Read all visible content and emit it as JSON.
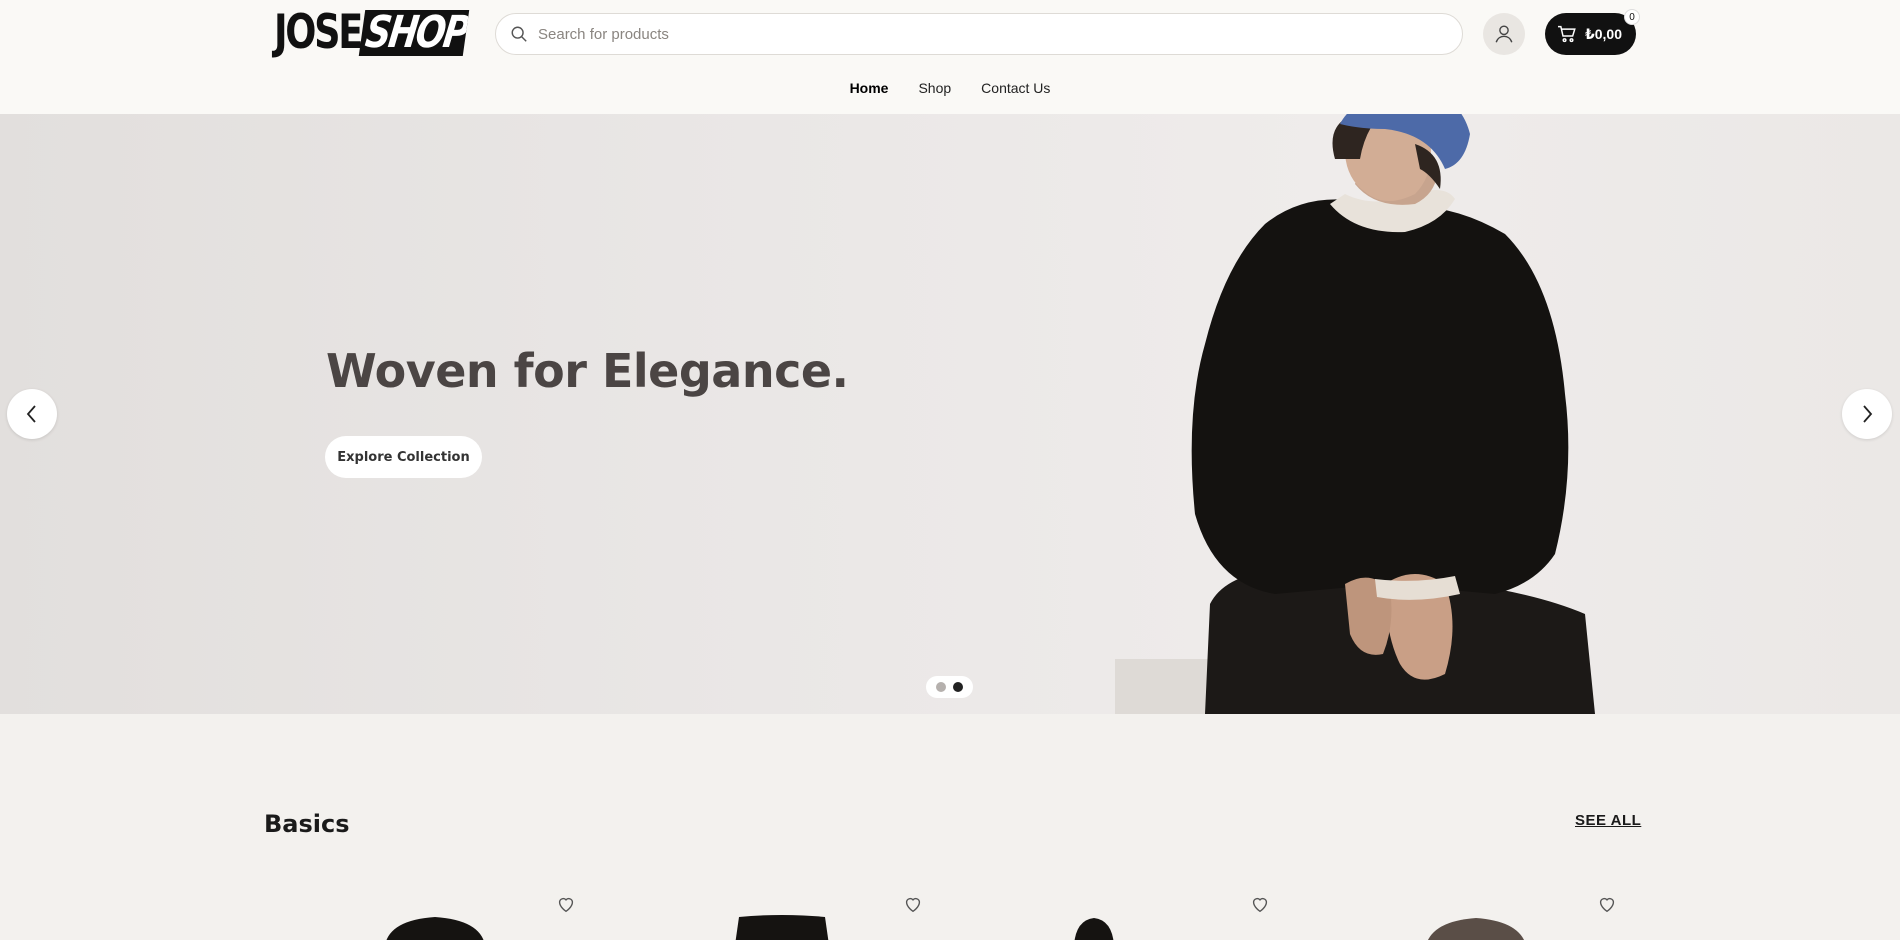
{
  "brand": {
    "logo_part1": "JOSE",
    "logo_part2": "SHOP"
  },
  "search": {
    "placeholder": "Search for products"
  },
  "cart": {
    "total": "₺0,00",
    "count": "0"
  },
  "nav": {
    "items": [
      {
        "label": "Home",
        "active": true
      },
      {
        "label": "Shop",
        "active": false
      },
      {
        "label": "Contact Us",
        "active": false
      }
    ]
  },
  "hero": {
    "title": "Woven for Elegance.",
    "cta_label": "Explore Collection",
    "slide_count": 2,
    "active_slide": 2
  },
  "basics": {
    "title": "Basics",
    "see_all_label": "SEE ALL"
  },
  "colors": {
    "accent": "#111111",
    "hero_title": "#4b4544",
    "page_bg": "#f3f1ee"
  }
}
